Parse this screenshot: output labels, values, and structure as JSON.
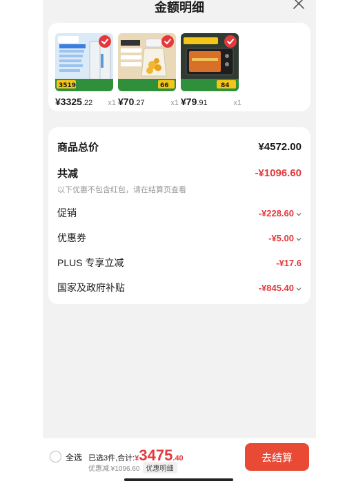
{
  "header": {
    "title": "金额明细"
  },
  "products": [
    {
      "price_int": "¥3325",
      "price_dec": ".22",
      "qty": "x1",
      "thumb_badge": "3519",
      "color": "#cfe4f5"
    },
    {
      "price_int": "¥70",
      "price_dec": ".27",
      "qty": "x1",
      "thumb_badge": "66",
      "color": "#e9d7b5"
    },
    {
      "price_int": "¥79",
      "price_dec": ".91",
      "qty": "x1",
      "thumb_badge": "84",
      "color": "#2b3a2c"
    }
  ],
  "details": {
    "total_label": "商品总价",
    "total_value": "¥4572.00",
    "reduce_label": "共减",
    "reduce_value": "-¥1096.60",
    "note": "以下优惠不包含红包，请在结算页查看",
    "items": [
      {
        "label": "促销",
        "value": "-¥228.60"
      },
      {
        "label": "优惠券",
        "value": "-¥5.00"
      },
      {
        "label": "PLUS 专享立减",
        "value": "-¥17.6"
      },
      {
        "label": "国家及政府补贴",
        "value": "-¥845.40"
      }
    ]
  },
  "footer": {
    "select_all": "全选",
    "selected_text": "已选3件,合计:",
    "currency": "¥",
    "total_int": "3475",
    "total_dec": ".40",
    "discount_text": "优惠减:¥1096.60",
    "detail_chip": "优惠明细",
    "checkout": "去结算"
  },
  "colors": {
    "accent": "#e4393c",
    "button": "#e94a35"
  }
}
